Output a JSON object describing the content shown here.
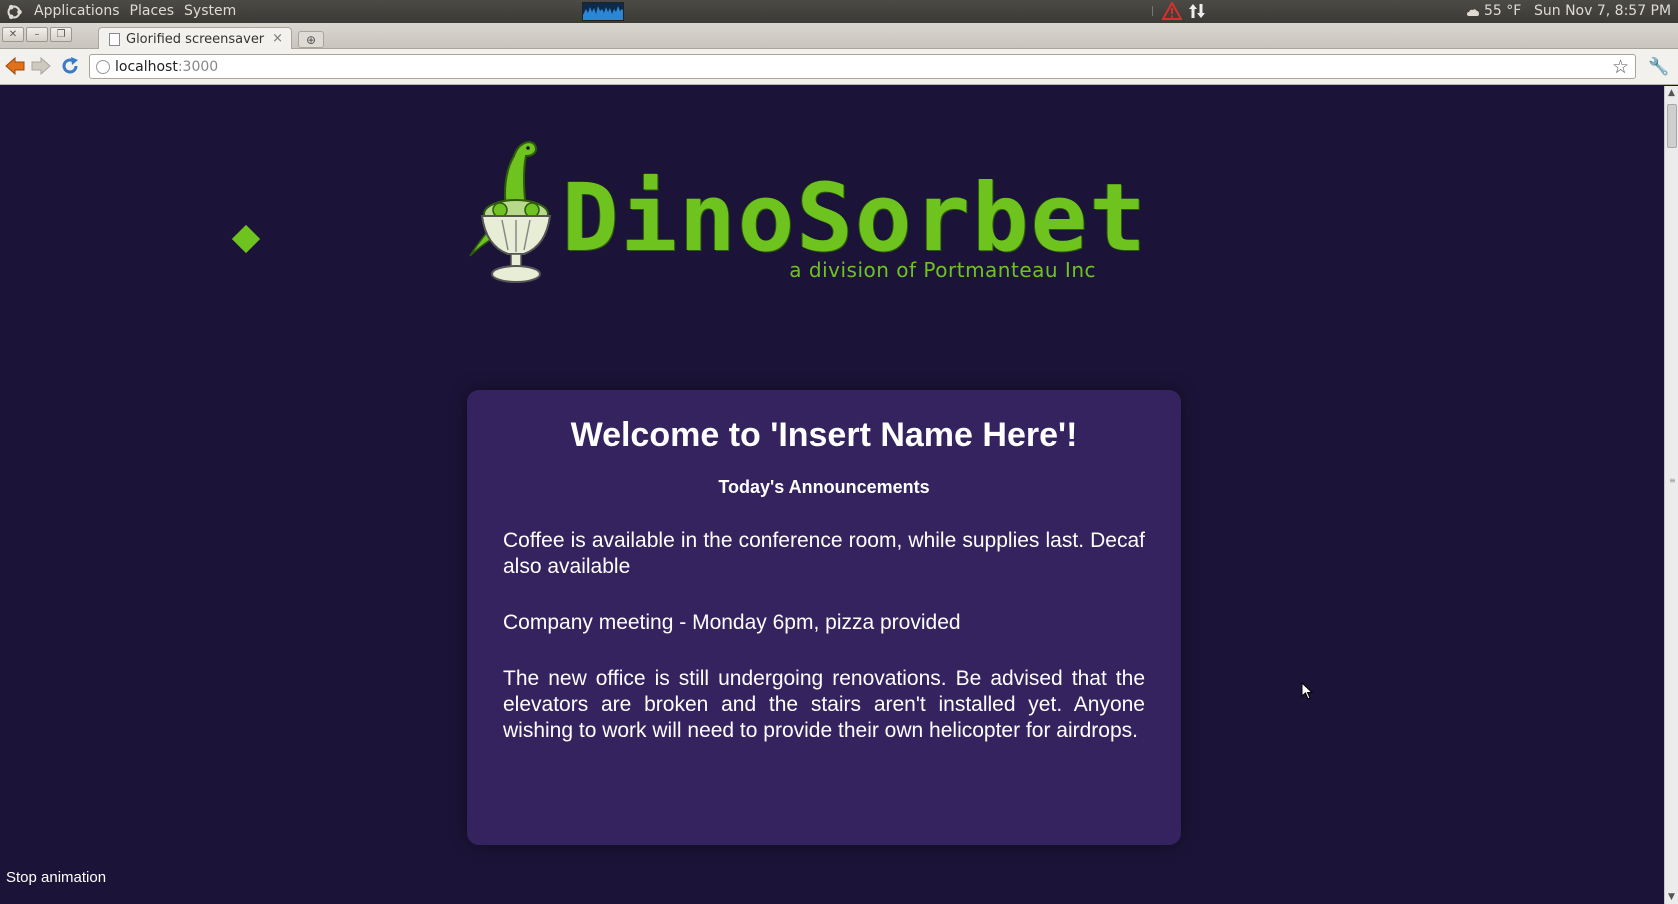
{
  "panel": {
    "menus": [
      "Applications",
      "Places",
      "System"
    ],
    "weather": "55 °F",
    "clock": "Sun Nov  7,  8:57 PM"
  },
  "browser": {
    "tab_title": "Glorified screensaver",
    "url_host": "localhost",
    "url_port": ":3000"
  },
  "page": {
    "brand": "DinoSorbet",
    "tagline": "a division of Portmanteau Inc",
    "welcome": "Welcome to 'Insert Name Here'!",
    "announcements_heading": "Today's Announcements",
    "announcements": [
      "Coffee is available in the conference room, while supplies last. Decaf also available",
      "Company meeting - Monday 6pm, pizza provided",
      "The new office is still undergoing renovations. Be advised that the elevators are broken and the stairs aren't installed yet. Anyone wishing to work will need to provide their own helicopter for airdrops."
    ],
    "stop_animation": "Stop animation"
  },
  "colors": {
    "page_bg": "#1c1438",
    "card_bg": "#35235f",
    "brand_green": "#6fc31f"
  },
  "icons": [
    "ubuntu-logo-icon",
    "system-monitor-icon",
    "warning-icon",
    "network-icon",
    "weather-icon",
    "page-icon",
    "tab-close-icon",
    "new-tab-icon",
    "back-icon",
    "forward-icon",
    "reload-icon",
    "globe-icon",
    "bookmark-star-icon",
    "wrench-icon",
    "dino-sundae-icon"
  ]
}
